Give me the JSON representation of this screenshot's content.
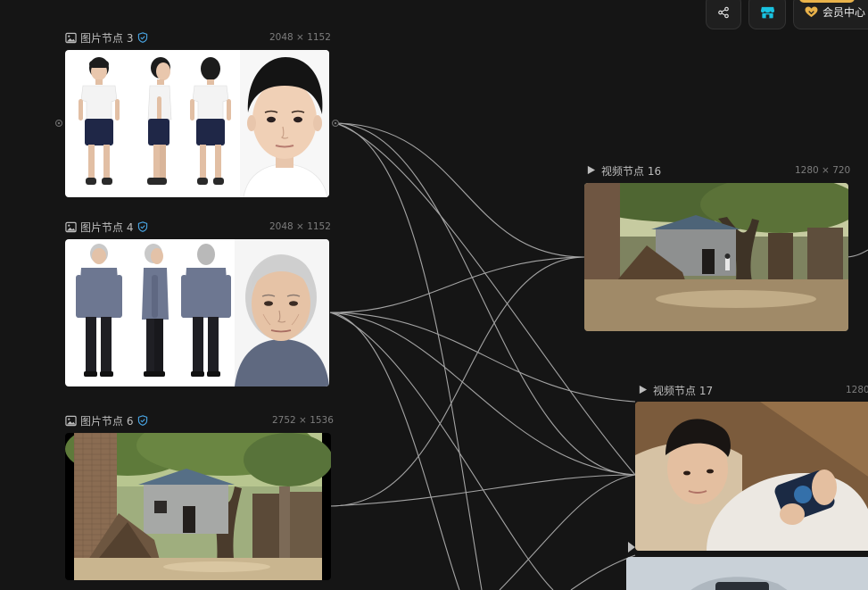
{
  "toolbar": {
    "share_icon": "share-icon",
    "store_icon": "store-icon",
    "member_label": "会员中心",
    "member_icon": "heart-badge-icon",
    "accent_color": "#e9b24a",
    "store_color": "#19c2e0"
  },
  "nodes": {
    "image3": {
      "title": "图片节点 3",
      "dims": "2048 × 1152",
      "type_icon": "image-icon",
      "verified_icon": "shield-check-icon"
    },
    "image4": {
      "title": "图片节点 4",
      "dims": "2048 × 1152",
      "type_icon": "image-icon",
      "verified_icon": "shield-check-icon"
    },
    "image6": {
      "title": "图片节点 6",
      "dims": "2752 × 1536",
      "type_icon": "image-icon",
      "verified_icon": "shield-check-icon"
    },
    "video16": {
      "title": "视频节点 16",
      "dims": "1280 × 720",
      "type_icon": "play-icon"
    },
    "video17": {
      "title": "视频节点 17",
      "dims": "1280",
      "type_icon": "play-icon"
    }
  },
  "colors": {
    "canvas_bg": "#151515",
    "edge": "#bdbdbd",
    "verified": "#4aa8e8"
  }
}
